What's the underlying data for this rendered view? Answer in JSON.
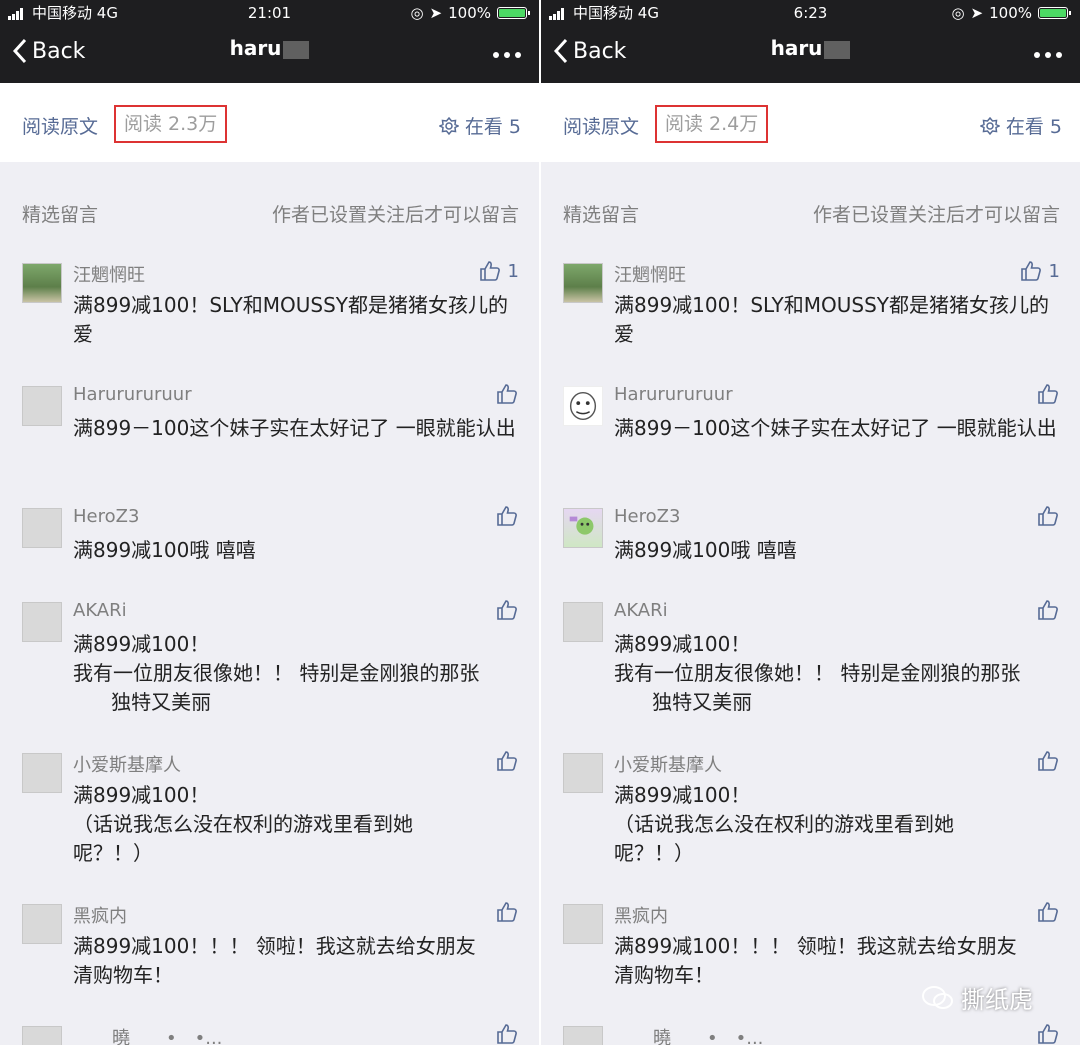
{
  "panes": [
    {
      "status": {
        "carrier": "中国移动",
        "network": "4G",
        "time": "21:01",
        "battery": "100%"
      },
      "nav": {
        "back": "Back",
        "title": "haru"
      },
      "read": {
        "original_label": "阅读原文",
        "count_label": "阅读 2.3万",
        "watching_label": "在看 5"
      },
      "comments_header": {
        "left": "精选留言",
        "right": "作者已设置关注后才可以留言"
      },
      "comments": [
        {
          "name": "汪魍惘旺",
          "likes": "1",
          "text": "满899减100！SLY和MOUSSY都是猪猪女孩儿的爱"
        },
        {
          "name": "Harurururuur",
          "likes": "",
          "text": "满899－100这个妹子实在太好记了 一眼就能认出"
        },
        {
          "name": "HeroZ3",
          "likes": "",
          "text": "满899减100哦 嘻嘻"
        },
        {
          "name": "AKARi",
          "likes": "",
          "text": "满899减100！\n我有一位朋友很像她！！ 特别是金刚狼的那张\n      独特又美丽"
        },
        {
          "name": "小爱斯基摩人",
          "likes": "",
          "text": "满899减100！\n（话说我怎么没在权利的游戏里看到她\n呢？！）"
        },
        {
          "name": "黑疯内",
          "likes": "",
          "text": "满899减100！！！ 领啦！我这就去给女朋友\n清购物车！"
        },
        {
          "name": "曉　　•　•...",
          "likes": "",
          "text": ""
        }
      ]
    },
    {
      "status": {
        "carrier": "中国移动",
        "network": "4G",
        "time": "6:23",
        "battery": "100%"
      },
      "nav": {
        "back": "Back",
        "title": "haru"
      },
      "read": {
        "original_label": "阅读原文",
        "count_label": "阅读 2.4万",
        "watching_label": "在看 5"
      },
      "comments_header": {
        "left": "精选留言",
        "right": "作者已设置关注后才可以留言"
      },
      "comments": [
        {
          "name": "汪魍惘旺",
          "likes": "1",
          "text": "满899减100！SLY和MOUSSY都是猪猪女孩儿的爱"
        },
        {
          "name": "Harurururuur",
          "likes": "",
          "text": "满899－100这个妹子实在太好记了 一眼就能认出"
        },
        {
          "name": "HeroZ3",
          "likes": "",
          "text": "满899减100哦 嘻嘻"
        },
        {
          "name": "AKARi",
          "likes": "",
          "text": "满899减100！\n我有一位朋友很像她！！ 特别是金刚狼的那张\n      独特又美丽"
        },
        {
          "name": "小爱斯基摩人",
          "likes": "",
          "text": "满899减100！\n（话说我怎么没在权利的游戏里看到她\n呢？！）"
        },
        {
          "name": "黑疯内",
          "likes": "",
          "text": "满899减100！！！ 领啦！我这就去给女朋友\n清购物车！"
        },
        {
          "name": "曉　　•　•...",
          "likes": "",
          "text": ""
        }
      ]
    }
  ],
  "watermark": "撕纸虎",
  "colors": {
    "link": "#576b95",
    "nav_bg": "#1e1e20",
    "highlight_box": "#dd3333"
  }
}
